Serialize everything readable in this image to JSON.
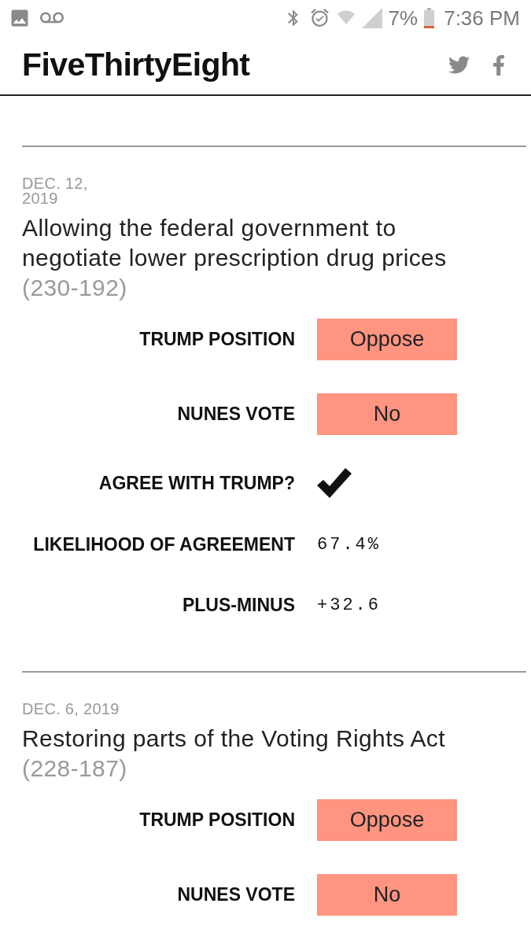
{
  "status_bar": {
    "battery": "7%",
    "time": "7:36 PM"
  },
  "header": {
    "logo": "FiveThirtyEight"
  },
  "votes": [
    {
      "date": "DEC. 12, 2019",
      "title": "Allowing the federal government to negotiate lower prescription drug prices",
      "tally": "(230-192)",
      "rows": [
        {
          "kind": "pill",
          "label": "TRUMP POSITION",
          "value": "Oppose"
        },
        {
          "kind": "pill",
          "label": "NUNES VOTE",
          "value": "No"
        },
        {
          "kind": "check",
          "label": "AGREE WITH TRUMP?",
          "checked": true
        },
        {
          "kind": "number",
          "label": "LIKELIHOOD OF AGREEMENT",
          "value": "67.4%"
        },
        {
          "kind": "number",
          "label": "PLUS-MINUS",
          "value": "+32.6"
        }
      ]
    },
    {
      "date": "DEC. 6, 2019",
      "title": "Restoring parts of the Voting Rights Act",
      "tally": "(228-187)",
      "rows": [
        {
          "kind": "pill",
          "label": "TRUMP POSITION",
          "value": "Oppose"
        },
        {
          "kind": "pill",
          "label": "NUNES VOTE",
          "value": "No"
        }
      ]
    }
  ]
}
